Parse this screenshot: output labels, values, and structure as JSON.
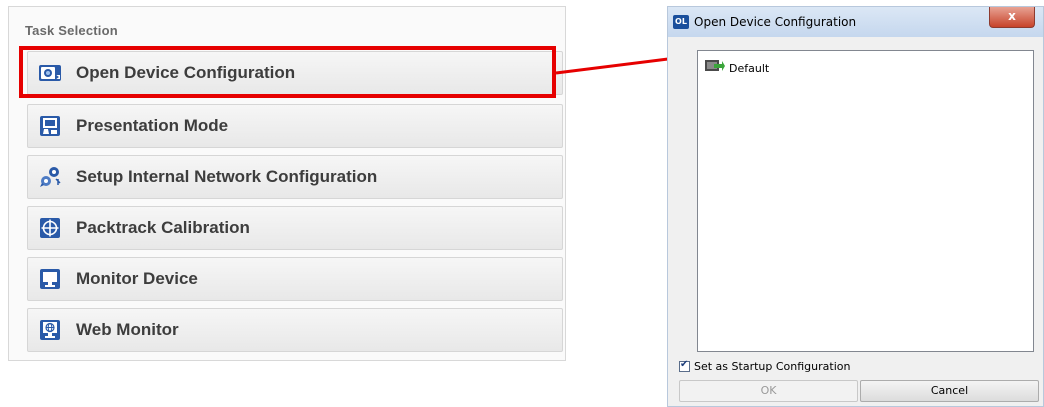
{
  "task_panel": {
    "header": "Task Selection",
    "items": [
      {
        "label": "Open Device Configuration",
        "icon": "open-device-icon"
      },
      {
        "label": "Presentation Mode",
        "icon": "presentation-icon"
      },
      {
        "label": "Setup Internal Network Configuration",
        "icon": "network-icon"
      },
      {
        "label": "Packtrack Calibration",
        "icon": "crosshair-icon"
      },
      {
        "label": "Monitor Device",
        "icon": "monitor-icon"
      },
      {
        "label": "Web Monitor",
        "icon": "web-monitor-icon"
      }
    ]
  },
  "dialog": {
    "app_icon_text": "OL",
    "title": "Open Device Configuration",
    "close_label": "x",
    "list_items": [
      {
        "label": "Default",
        "icon": "configuration-icon"
      }
    ],
    "startup_checkbox_label": "Set as Startup Configuration",
    "startup_checked": true,
    "ok_label": "OK",
    "cancel_label": "Cancel"
  },
  "colors": {
    "highlight": "#e60000",
    "icon_blue": "#2a5aa8"
  }
}
